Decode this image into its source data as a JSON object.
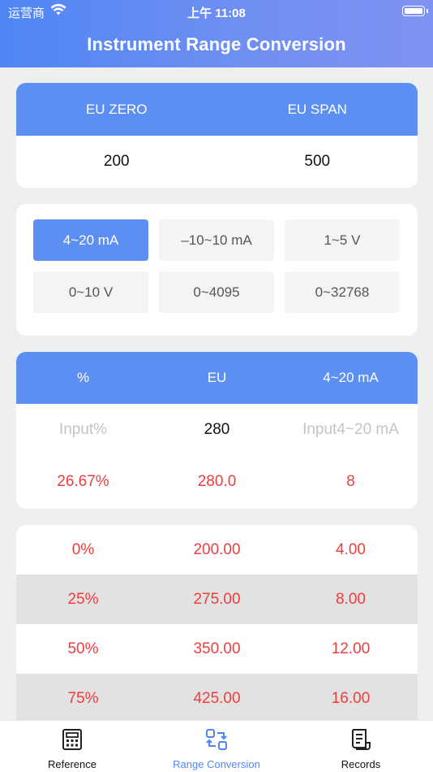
{
  "status_bar": {
    "carrier": "运营商",
    "time": "上午 11:08"
  },
  "header": {
    "title": "Instrument Range Conversion"
  },
  "range": {
    "zero_label": "EU ZERO",
    "span_label": "EU SPAN",
    "zero_value": "200",
    "span_value": "500"
  },
  "signal_types": [
    {
      "label": "4~20 mA",
      "active": true
    },
    {
      "label": "–10~10 mA",
      "active": false
    },
    {
      "label": "1~5 V",
      "active": false
    },
    {
      "label": "0~10 V",
      "active": false
    },
    {
      "label": "0~4095",
      "active": false
    },
    {
      "label": "0~32768",
      "active": false
    }
  ],
  "converter": {
    "headers": [
      "%",
      "EU",
      "4~20 mA"
    ],
    "percent_placeholder": "Input%",
    "eu_input": "280",
    "ma_placeholder": "Input4~20 mA",
    "results": [
      "26.67%",
      "280.0",
      "8"
    ]
  },
  "table": {
    "rows": [
      [
        "0%",
        "200.00",
        "4.00"
      ],
      [
        "25%",
        "275.00",
        "8.00"
      ],
      [
        "50%",
        "350.00",
        "12.00"
      ],
      [
        "75%",
        "425.00",
        "16.00"
      ]
    ]
  },
  "tabbar": {
    "tabs": [
      {
        "label": "Reference",
        "icon": "calculator-icon",
        "active": false
      },
      {
        "label": "Range Conversion",
        "icon": "convert-icon",
        "active": true
      },
      {
        "label": "Records",
        "icon": "records-icon",
        "active": false
      }
    ]
  },
  "colors": {
    "accent": "#5d8ff2",
    "result": "#ee3d3d",
    "placeholder": "#c4c4c4"
  }
}
